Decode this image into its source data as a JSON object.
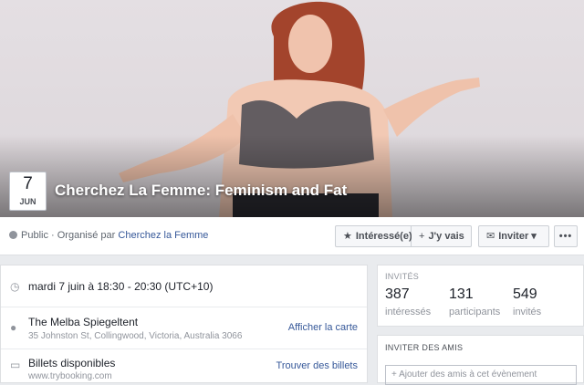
{
  "event": {
    "date_day": "7",
    "date_month": "JUN",
    "title": "Cherchez La Femme: Feminism and Fat"
  },
  "meta": {
    "prefix": "Public · Organisé par",
    "organizer": "Cherchez la Femme"
  },
  "actions": {
    "interested_icon": "★",
    "interested": "Intéressé(e)",
    "going_icon": "+",
    "going": "J'y vais",
    "invite_icon": "✉",
    "invite": "Inviter",
    "invite_caret": "▾",
    "more": "•••"
  },
  "details": {
    "time_icon": "clock-icon",
    "time": "mardi 7 juin à 18:30 - 20:30 (UTC+10)",
    "location_name": "The Melba Spiegeltent",
    "location_address": "35 Johnston St, Collingwood, Victoria, Australia 3066",
    "map_link": "Afficher la carte",
    "tickets_title": "Billets disponibles",
    "tickets_url": "www.trybooking.com",
    "tickets_link": "Trouver des billets"
  },
  "guests": {
    "heading": "INVITÉS",
    "interested_count": "387",
    "interested_label": "intéressés",
    "going_count": "131",
    "going_label": "participants",
    "invited_count": "549",
    "invited_label": "invités"
  },
  "invite_friends": {
    "heading": "INVITER DES AMIS",
    "placeholder": "+ Ajouter des amis à cet évènement"
  },
  "colors": {
    "link": "#365899",
    "page_bg": "#e9ebee"
  }
}
